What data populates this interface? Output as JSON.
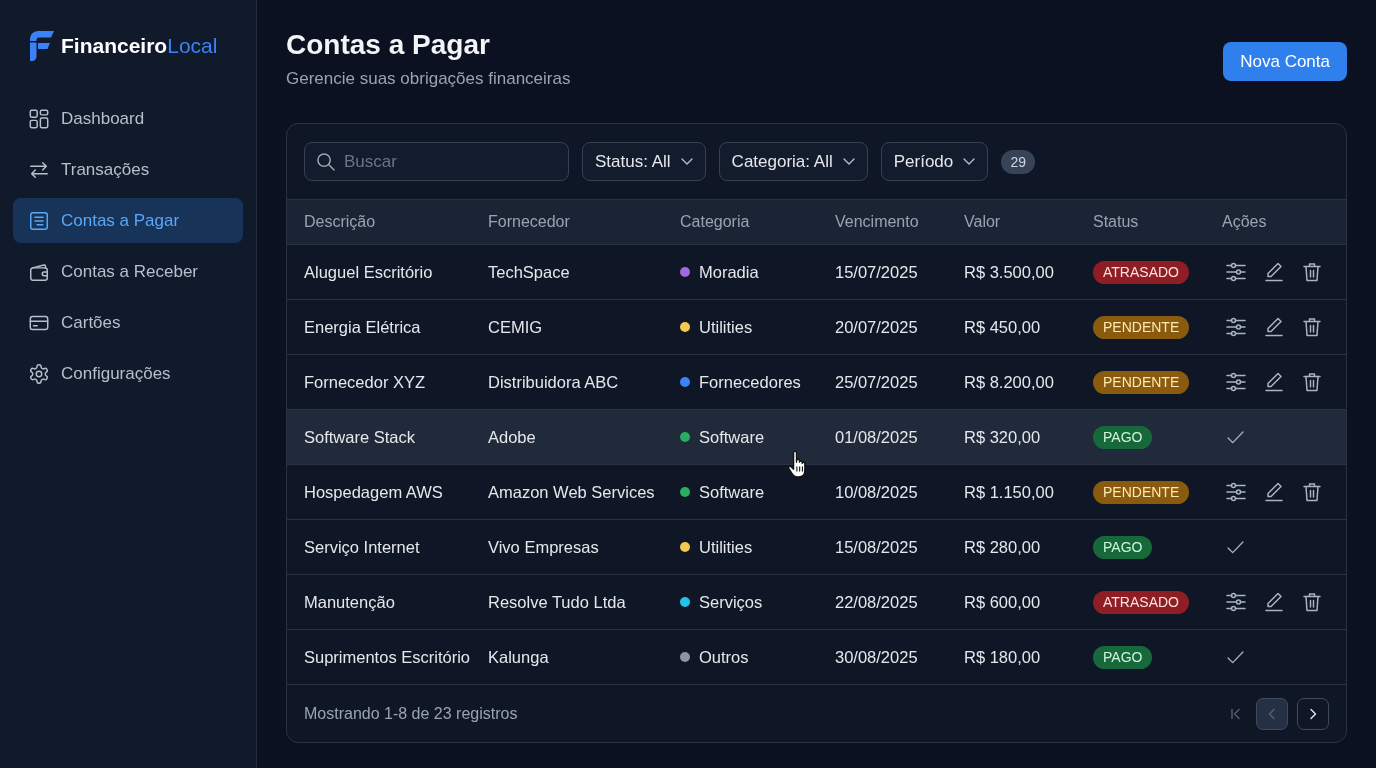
{
  "sidebar": {
    "brand": "**Financeiro**Local",
    "items": [
      {
        "label": "Dashboard",
        "kind": "grid",
        "selected": false
      },
      {
        "label": "Transações",
        "kind": "arrows",
        "selected": false
      },
      {
        "label": "Contas a Pagar",
        "kind": "document",
        "selected": true
      },
      {
        "label": "Contas a Receber",
        "kind": "wallet",
        "selected": false
      },
      {
        "label": "Cartões",
        "kind": "card",
        "selected": false
      },
      {
        "label": "Configurações",
        "kind": "gear",
        "selected": false
      }
    ]
  },
  "header": {
    "title": "Contas a Pagar",
    "subtitle": "Gerencie suas obrigações financeiras",
    "action": "Nova Conta"
  },
  "toolbar": {
    "search": {
      "placeholder": "Buscar"
    },
    "filters": [
      {
        "label": "Status: All"
      },
      {
        "label": "Categoria: All"
      },
      {
        "label": "Período"
      }
    ],
    "count": "29"
  },
  "table": {
    "columns": [
      "Descrição",
      "Fornecedor",
      "Categoria",
      "Vencimento",
      "Valor",
      "Status",
      "Ações"
    ],
    "rows": [
      {
        "description": "Aluguel Escritório",
        "supplier": "TechSpace",
        "category": {
          "label": "Moradia",
          "color": "#a36ae0"
        },
        "due": "15/07/2025",
        "amount": "R$ 3.500,00",
        "status": {
          "label": "ATRASADO",
          "kind": "overdue"
        },
        "settled": false,
        "highlighted": false
      },
      {
        "description": "Energia Elétrica",
        "supplier": "CEMIG",
        "category": {
          "label": "Utilities",
          "color": "#f2c94c"
        },
        "due": "20/07/2025",
        "amount": "R$ 450,00",
        "status": {
          "label": "PENDENTE",
          "kind": "pending"
        },
        "settled": false,
        "highlighted": false
      },
      {
        "description": "Fornecedor XYZ",
        "supplier": "Distribuidora ABC",
        "category": {
          "label": "Fornecedores",
          "color": "#3b82f6"
        },
        "due": "25/07/2025",
        "amount": "R$ 8.200,00",
        "status": {
          "label": "PENDENTE",
          "kind": "pending"
        },
        "settled": false,
        "highlighted": false
      },
      {
        "description": "Software Stack",
        "supplier": "Adobe",
        "category": {
          "label": "Software",
          "color": "#27ae60"
        },
        "due": "01/08/2025",
        "amount": "R$ 320,00",
        "status": {
          "label": "PAGO",
          "kind": "paid"
        },
        "settled": true,
        "highlighted": true
      },
      {
        "description": "Hospedagem AWS",
        "supplier": "Amazon Web Services",
        "category": {
          "label": "Software",
          "color": "#27ae60"
        },
        "due": "10/08/2025",
        "amount": "R$ 1.150,00",
        "status": {
          "label": "PENDENTE",
          "kind": "pending"
        },
        "settled": false,
        "highlighted": false
      },
      {
        "description": "Serviço Internet",
        "supplier": "Vivo Empresas",
        "category": {
          "label": "Utilities",
          "color": "#f2c94c"
        },
        "due": "15/08/2025",
        "amount": "R$ 280,00",
        "status": {
          "label": "PAGO",
          "kind": "paid"
        },
        "settled": true,
        "highlighted": false
      },
      {
        "description": "Manutenção",
        "supplier": "Resolve Tudo Ltda",
        "category": {
          "label": "Serviços",
          "color": "#22c3e6"
        },
        "due": "22/08/2025",
        "amount": "R$ 600,00",
        "status": {
          "label": "ATRASADO",
          "kind": "overdue"
        },
        "settled": false,
        "highlighted": false
      },
      {
        "description": "Suprimentos Escritório",
        "supplier": "Kalunga",
        "category": {
          "label": "Outros",
          "color": "#8a94a3"
        },
        "due": "30/08/2025",
        "amount": "R$ 180,00",
        "status": {
          "label": "PAGO",
          "kind": "paid"
        },
        "settled": true,
        "highlighted": false
      }
    ]
  },
  "footer": {
    "summary": "Mostrando 1-8 de 23 registros",
    "pagination": [
      {
        "kind": "first",
        "disabled": true
      },
      {
        "kind": "prev",
        "disabled": true
      },
      {
        "kind": "next",
        "disabled": false
      }
    ]
  }
}
